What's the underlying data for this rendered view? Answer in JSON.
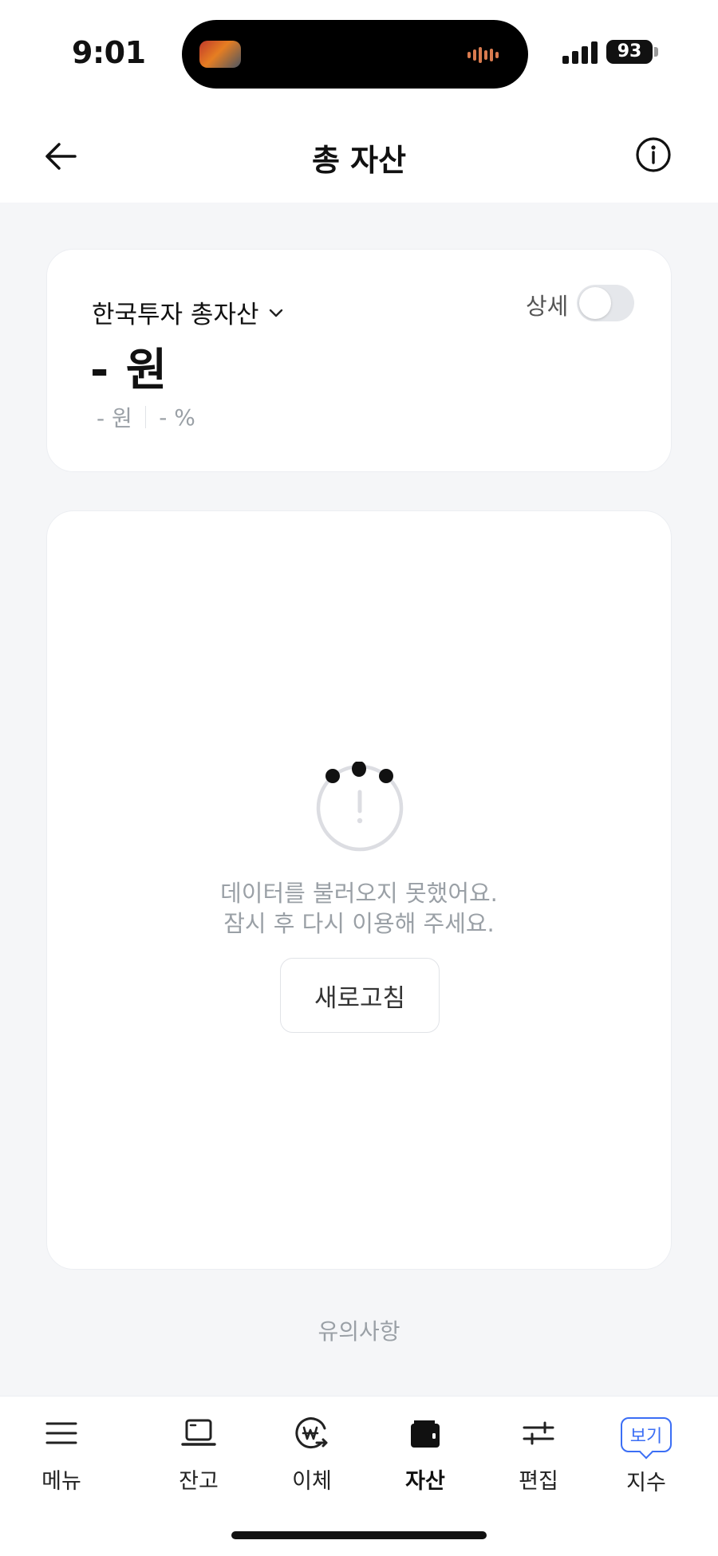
{
  "status_bar": {
    "time": "9:01",
    "battery": "93"
  },
  "header": {
    "title": "총 자산"
  },
  "summary": {
    "account_label": "한국투자 총자산",
    "amount": "- 원",
    "sub_amount": "- 원",
    "sub_percent": "- %",
    "detail_label": "상세",
    "detail_toggle_on": false
  },
  "main": {
    "error_line1": "데이터를 불러오지 못했어요.",
    "error_line2": "잠시 후 다시 이용해 주세요.",
    "refresh_label": "새로고침"
  },
  "notice_label": "유의사항",
  "tabs": [
    {
      "label": "메뉴",
      "icon": "menu-icon"
    },
    {
      "label": "잔고",
      "icon": "laptop-icon"
    },
    {
      "label": "이체",
      "icon": "transfer-won-icon"
    },
    {
      "label": "자산",
      "icon": "wallet-icon",
      "active": true
    },
    {
      "label": "편집",
      "icon": "sliders-icon"
    },
    {
      "label": "지수",
      "icon": "view-badge",
      "badge": "보기"
    }
  ],
  "colors": {
    "accent": "#3b6ef5",
    "muted": "#9aa0a6",
    "background": "#f5f6f8"
  }
}
